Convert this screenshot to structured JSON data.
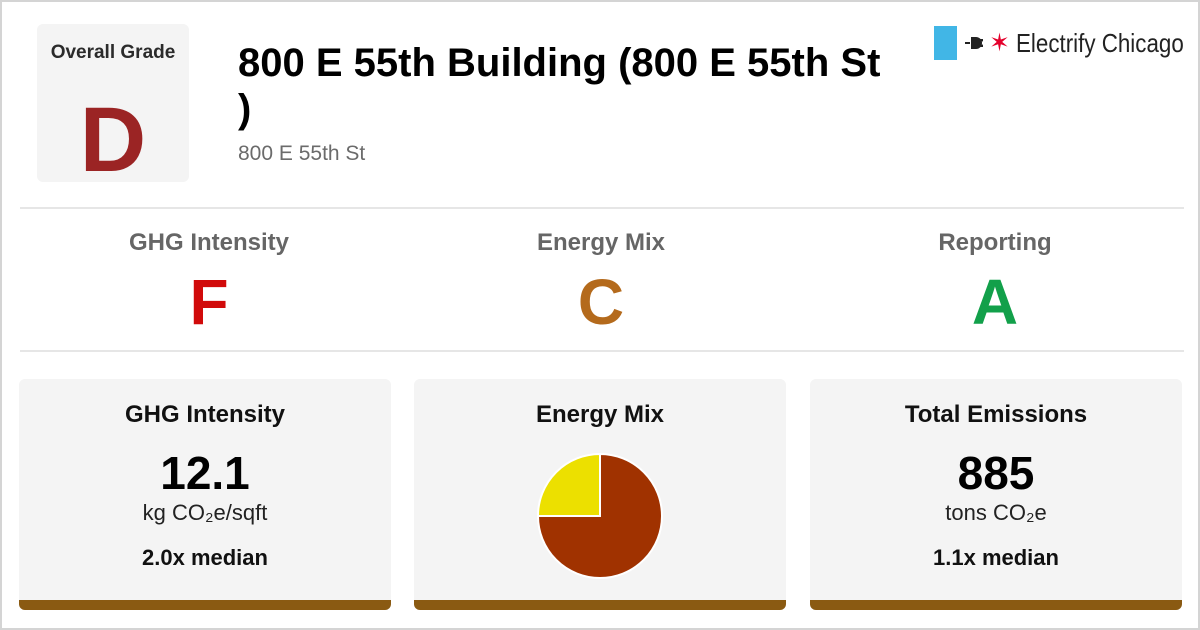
{
  "header": {
    "overall_grade_label": "Overall Grade",
    "overall_grade": "D",
    "building_title": "800 E 55th Building (800 E 55th St )",
    "address": "800 E 55th St"
  },
  "logo": {
    "text": "Electrify Chicago",
    "icons": [
      "chicago-flag-stripe-icon",
      "plug-icon",
      "chicago-star-icon"
    ]
  },
  "subgrades": [
    {
      "label": "GHG Intensity",
      "grade": "F",
      "color": "#d10a0a"
    },
    {
      "label": "Energy Mix",
      "grade": "C",
      "color": "#b46a1c"
    },
    {
      "label": "Reporting",
      "grade": "A",
      "color": "#12a04a"
    }
  ],
  "cards": {
    "ghg": {
      "title": "GHG Intensity",
      "value": "12.1",
      "unit": "kg CO₂e/sqft",
      "median": "2.0x median"
    },
    "mix": {
      "title": "Energy Mix"
    },
    "emissions": {
      "title": "Total Emissions",
      "value": "885",
      "unit": "tons CO₂e",
      "median": "1.1x median"
    }
  },
  "colors": {
    "overall_grade": "#9b2424",
    "card_bar": "#8a5a12",
    "logo_blue": "#41b6e6",
    "logo_red": "#e4002b"
  },
  "chart_data": {
    "type": "pie",
    "slices": [
      {
        "value": 75,
        "color": "#a03200"
      },
      {
        "value": 25,
        "color": "#ece000"
      }
    ]
  }
}
